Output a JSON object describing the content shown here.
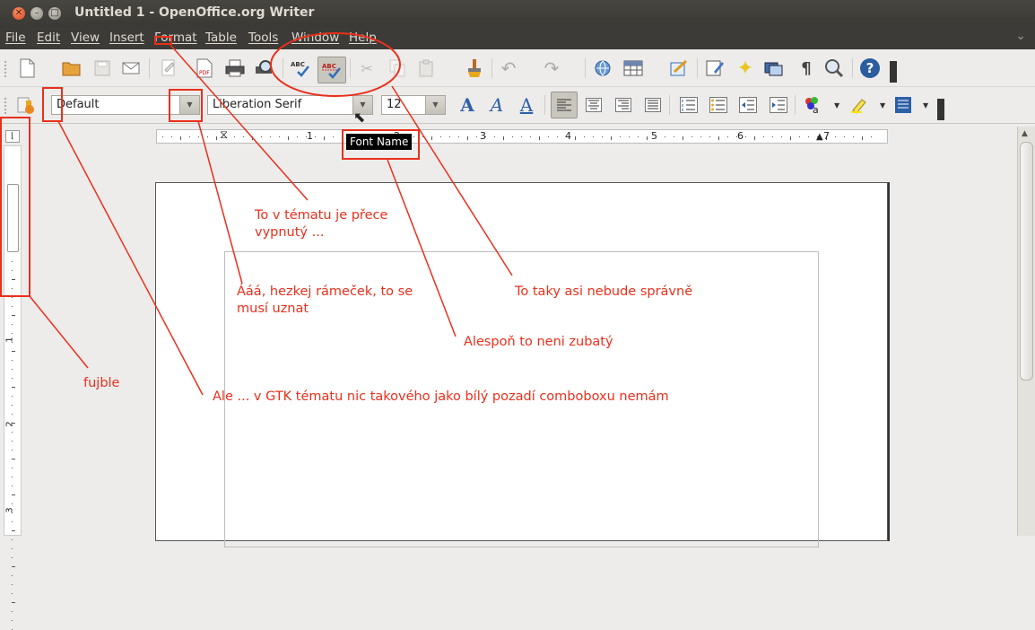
{
  "window": {
    "title": "Untitled 1 - OpenOffice.org Writer"
  },
  "menubar": {
    "items": [
      "File",
      "Edit",
      "View",
      "Insert",
      "Format",
      "Table",
      "Tools",
      "Window",
      "Help"
    ]
  },
  "toolbar": {
    "para_style": "Default",
    "font_name": "Liberation Serif",
    "font_size": "12",
    "tooltip": "Font Name",
    "spell_label": "ABC",
    "autospell_label": "ABC",
    "pilcrow": "¶",
    "help": "?"
  },
  "ruler": {
    "numbers": [
      "1",
      "2",
      "3",
      "4",
      "5",
      "6",
      "7"
    ],
    "vnumbers": [
      "1",
      "2",
      "3"
    ]
  },
  "annotations": {
    "theme_disabled": "To v tématu je přece\nvypnutý ...",
    "frame": "Ááá, hezkej rámeček, to se\nmusí uznat",
    "not_correct": "To taky asi nebude správně",
    "not_jagged": "Alespoň to neni zubatý",
    "fujble": "fujble",
    "white_bg": "Ale ... v GTK tématu nic takového jako bílý pozadí comboboxu nemám"
  },
  "colors": {
    "annotation": "#e9301c",
    "titlebar": "#3c3b37"
  }
}
